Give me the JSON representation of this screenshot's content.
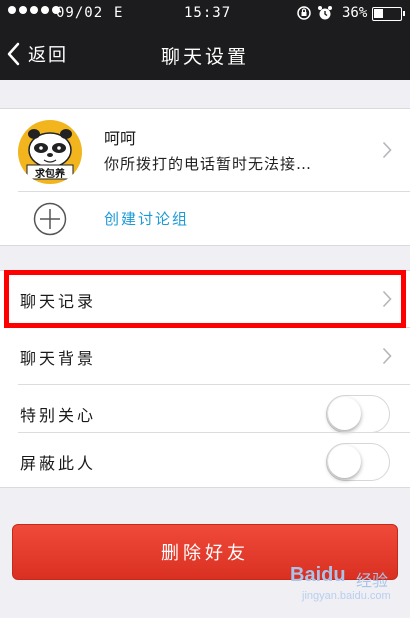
{
  "status_bar": {
    "date": "09/02",
    "carrier": "E",
    "time": "15:37",
    "battery_percent": "36%",
    "battery_level": 0.36
  },
  "nav": {
    "back_label": "返回",
    "title": "聊天设置"
  },
  "contact": {
    "name": "呵呵",
    "signature": "你所拨打的电话暂时无法接…",
    "avatar_text": "求包养"
  },
  "create_group": {
    "label": "创建讨论组"
  },
  "settings": [
    {
      "label": "聊天记录",
      "control": "chevron",
      "highlighted": true
    },
    {
      "label": "聊天背景",
      "control": "chevron"
    },
    {
      "label": "特别关心",
      "control": "toggle",
      "value": false
    },
    {
      "label": "屏蔽此人",
      "control": "toggle",
      "value": false
    }
  ],
  "delete_button": {
    "label": "删除好友",
    "color": "#e53b2c"
  },
  "watermark": {
    "logo": "Baidu",
    "cn": "经验",
    "url": "jingyan.baidu.com"
  },
  "colors": {
    "accent_link": "#1a9ad8",
    "highlight_border": "#ff0000",
    "nav_bg": "#1c1c1e"
  },
  "icons": [
    "back-chevron-icon",
    "chevron-right-icon",
    "plus-circle-icon",
    "alarm-icon",
    "rotation-lock-icon",
    "battery-icon",
    "signal-icon"
  ]
}
